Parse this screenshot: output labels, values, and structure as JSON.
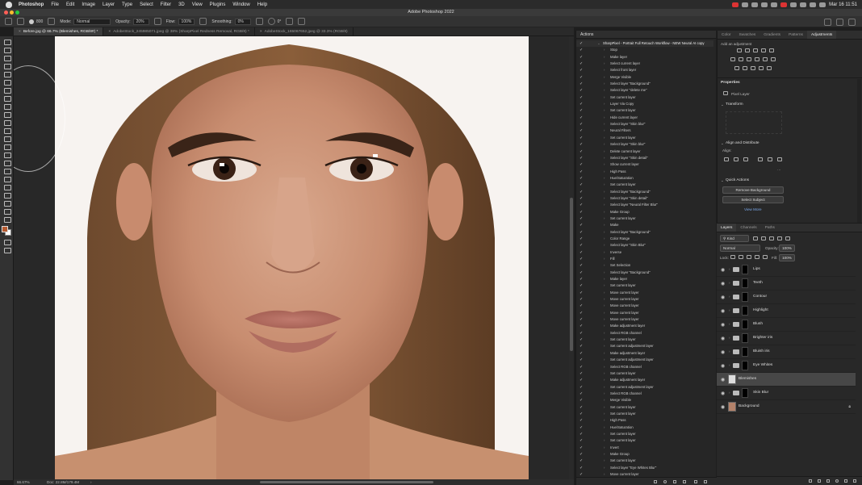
{
  "menubar": {
    "app": "Photoshop",
    "items": [
      "File",
      "Edit",
      "Image",
      "Layer",
      "Type",
      "Select",
      "Filter",
      "3D",
      "View",
      "Plugins",
      "Window",
      "Help"
    ],
    "clock": "Mar 16  11:51"
  },
  "window": {
    "title": "Adobe Photoshop 2022"
  },
  "options": {
    "brush_size": "800",
    "mode_label": "Mode:",
    "mode_value": "Normal",
    "opacity_label": "Opacity:",
    "opacity_value": "20%",
    "flow_label": "Flow:",
    "flow_value": "100%",
    "smoothing_label": "Smoothing:",
    "smoothing_value": "0%",
    "angle_value": "0°"
  },
  "tabs": [
    {
      "label": "Before.jpg @ 66.7% (Blemishes, RGB/8#) *"
    },
    {
      "label": "AdobeStock_245985071.jpeg @ 38% (SharpPixel Redness Removal, RGB/8) *"
    },
    {
      "label": "AdobeStock_165067652.jpeg @ 33.3% (RGB/8)"
    }
  ],
  "status": {
    "zoom": "66.67%",
    "doc": "Doc: 22.8M/179.4M"
  },
  "actions_panel": {
    "title": "Actions",
    "header_row": "SharpPixel - Portrait Full Retouch Workflow - NEW Neural AI copy",
    "rows": [
      "Stop",
      "Make layer",
      "Select current layer",
      "Select front layer",
      "Merge Visible",
      "Select layer \"Background\"",
      "Select layer \"delete me\"",
      "Set current layer",
      "Layer Via Copy",
      "Set current layer",
      "Hide current layer",
      "Select layer \"Skin blur\"",
      "Neural Filters",
      "Set current layer",
      "Select layer \"Skin blur\"",
      "Delete current layer",
      "Select layer \"Skin detail\"",
      "Show current layer",
      "High Pass",
      "Hue/Saturation",
      "Set current layer",
      "Select layer \"Background\"",
      "Select layer \"Skin detail\"",
      "Select layer \"Neural Filter Blur\"",
      "Make Group",
      "Set current layer",
      "Make",
      "Select layer \"Background\"",
      "Color Range",
      "Select layer \"Skin Blur\"",
      "Inverse",
      "Fill",
      "Set Selection",
      "Select layer \"Background\"",
      "Make layer",
      "Set current layer",
      "Move current layer",
      "Move current layer",
      "Move current layer",
      "Move current layer",
      "Move current layer",
      "Make adjustment layer",
      "Select RGB channel",
      "Set current layer",
      "Set current adjustment layer",
      "Make adjustment layer",
      "Set current adjustment layer",
      "Select RGB channel",
      "Set current layer",
      "Make adjustment layer",
      "Set current adjustment layer",
      "Select RGB channel",
      "Merge Visible",
      "Set current layer",
      "Set current layer",
      "High Pass",
      "Hue/Saturation",
      "Set current layer",
      "Set current layer",
      "Invert",
      "Make Group",
      "Set current layer",
      "Select layer \"Eye Whites Blur\"",
      "Move current layer"
    ]
  },
  "right_panel": {
    "tabs": [
      "Color",
      "Swatches",
      "Gradients",
      "Patterns",
      "Adjustments"
    ],
    "add_adjustment": "Add an adjustment",
    "properties_title": "Properties",
    "pixel_layer": "Pixel Layer",
    "transform": "Transform",
    "align_distribute": "Align and Distribute",
    "align": "Align:",
    "quick_actions": "Quick Actions",
    "remove_background": "Remove Background",
    "select_subject": "Select Subject",
    "view_more": "View More"
  },
  "layers_panel": {
    "tabs": [
      "Layers",
      "Channels",
      "Paths"
    ],
    "kind": "Kind",
    "blend_mode": "Normal",
    "opacity_label": "Opacity:",
    "opacity_value": "100%",
    "lock_label": "Lock:",
    "fill_label": "Fill:",
    "fill_value": "100%",
    "layers": [
      {
        "name": "Lips"
      },
      {
        "name": "Teeth"
      },
      {
        "name": "Contour"
      },
      {
        "name": "Highlight"
      },
      {
        "name": "Blush"
      },
      {
        "name": "Brighter iris"
      },
      {
        "name": "Bluish iris"
      },
      {
        "name": "Eye Whites"
      },
      {
        "name": "Blemishes"
      },
      {
        "name": "Skin Blur"
      },
      {
        "name": "Background"
      }
    ]
  },
  "colors": {
    "foreground": "#b65a30",
    "background": "#ffffff",
    "accent": "#7aa7e8"
  }
}
